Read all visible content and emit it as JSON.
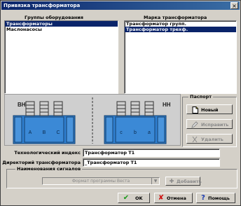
{
  "window": {
    "title": "Привязка трансформатора",
    "close_glyph": "×"
  },
  "groups": {
    "header": "Группы оборудования",
    "items": [
      {
        "label": "Трансформаторы",
        "selected": true
      },
      {
        "label": "Маслонасосы",
        "selected": false
      }
    ]
  },
  "marks": {
    "header": "Марка трансформатора",
    "items": [
      {
        "label": "Трансформатор групп.",
        "selected": false
      },
      {
        "label": "Трансформатор трехф.",
        "selected": true
      }
    ]
  },
  "diagram": {
    "left_label": "ВН",
    "right_label": "НН",
    "phases_left": [
      "A",
      "B",
      "C"
    ],
    "phases_right": [
      "c",
      "b",
      "a"
    ]
  },
  "passport": {
    "label": "Паспорт",
    "new_label": "Новый",
    "edit_label": "Исправить",
    "delete_label": "Удалить"
  },
  "fields": {
    "tech_index_label": "Технологический индекс",
    "tech_index_value": "Трансформатор Т1",
    "dir_label": "Директорий трансформатора",
    "dir_value": "_Трансформатор Т1"
  },
  "signals": {
    "label": "Наименования сигналов",
    "combo_value": "Формат программы Веста",
    "add_label": "Добавить"
  },
  "footer": {
    "ok_label": "OK",
    "cancel_label": "Отмена",
    "help_label": "Помощь"
  },
  "colors": {
    "title_bar": "#0a246a",
    "selection": "#0a246a",
    "transformer": "#2f7fd0"
  }
}
